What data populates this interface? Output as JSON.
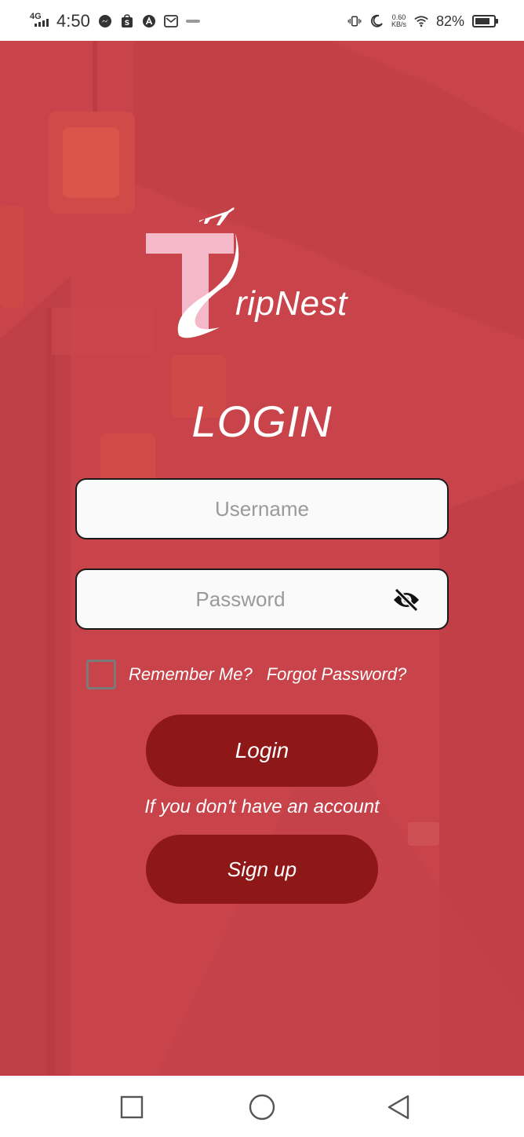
{
  "status_bar": {
    "network": "4G",
    "time": "4:50",
    "speed_value": "0.60",
    "speed_unit": "KB/s",
    "battery_text": "82%",
    "battery_level": 0.82
  },
  "logo": {
    "text": "ripNest"
  },
  "login": {
    "title": "LOGIN",
    "username_placeholder": "Username",
    "password_placeholder": "Password",
    "remember_label": "Remember Me?",
    "forgot_label": "Forgot Password?",
    "login_button": "Login",
    "no_account_text": "If you don't have an account",
    "signup_button": "Sign up"
  },
  "colors": {
    "background": "#c8434a",
    "button": "#8e1718",
    "text": "#ffffff"
  },
  "icons": {
    "password_toggle": "eye-off-icon",
    "nav_recents": "square-icon",
    "nav_home": "circle-icon",
    "nav_back": "triangle-back-icon"
  }
}
